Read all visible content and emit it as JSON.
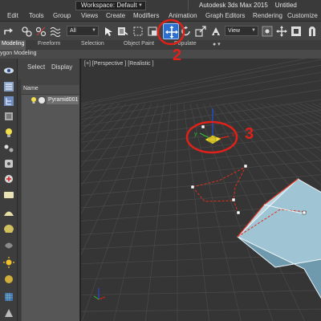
{
  "window": {
    "workspace_label": "Workspace: Default",
    "app_title": "Autodesk 3ds Max  2015",
    "doc_title": "Untitled"
  },
  "menu": [
    "Edit",
    "Tools",
    "Group",
    "Views",
    "Create",
    "Modifiers",
    "Animation",
    "Graph Editors",
    "Rendering",
    "Customize"
  ],
  "toolbar": {
    "selection_filter": "All",
    "ref_coord": "View"
  },
  "ribbon": {
    "tabs": [
      "Modeling",
      "Freeform",
      "Selection",
      "Object Paint",
      "Populate"
    ],
    "subtab": "ygon Modeling"
  },
  "explorer": {
    "tabs": [
      "Select",
      "Display"
    ],
    "column_header": "Name",
    "objects": [
      "Pyramid001"
    ]
  },
  "viewport": {
    "label": "[+] [Perspective ] [Realistic ]",
    "gizmo_axes": [
      "y",
      "x"
    ]
  },
  "annotations": {
    "move_tool": "2",
    "gizmo": "3"
  },
  "colors": {
    "accent": "#2d6fcf",
    "annotation": "#e0211a",
    "selection": "#e0301e"
  }
}
